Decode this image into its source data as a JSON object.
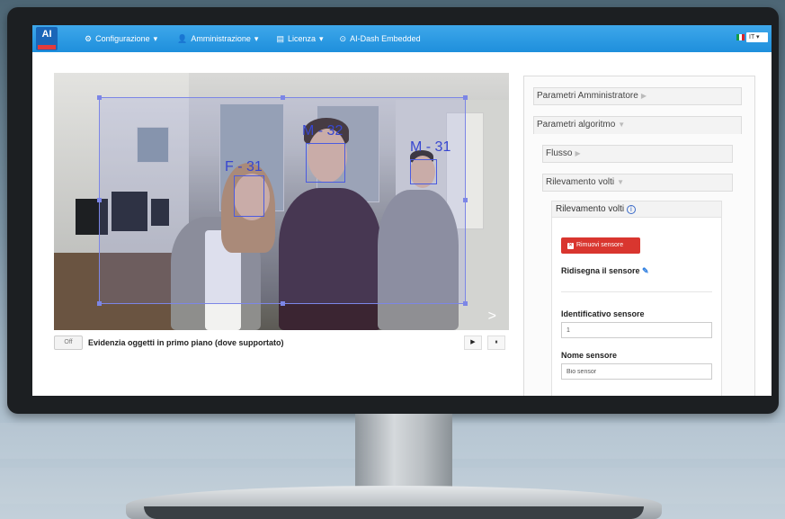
{
  "navbar": {
    "logo_text": "AI",
    "items": [
      {
        "label": "Configurazione",
        "icon": "gear-icon"
      },
      {
        "label": "Amministrazione",
        "icon": "user-icon"
      },
      {
        "label": "Licenza",
        "icon": "license-icon"
      },
      {
        "label": "AI-Dash Embedded",
        "icon": "dash-icon"
      }
    ],
    "language": "IT"
  },
  "video": {
    "face_labels": [
      "M - 32",
      "F - 31",
      "M - 31"
    ],
    "next_label": ">"
  },
  "controls": {
    "toggle_state": "Off",
    "toggle_label": "Evidenzia oggetti in primo piano (dove supportato)",
    "play_label": "▶",
    "pause_label": "⏸"
  },
  "panel": {
    "admin_params": "Parametri Amministratore",
    "algo_params": "Parametri algoritmo",
    "flow": "Flusso",
    "face_detection": "Rilevamento volti",
    "face_detection_inner": "Rilevamento volti",
    "remove_sensor": "Rimuovi sensore",
    "redraw_sensor": "Ridisegna il sensore",
    "sensor_id_label": "Identificativo sensore",
    "sensor_id_value": "1",
    "sensor_name_label": "Nome sensore",
    "sensor_name_value": "Bio sensor"
  },
  "colors": {
    "navbar": "#2196e0",
    "remove_button": "#d9362f",
    "roi_box": "#7c86e6",
    "face_box": "#4b5be0"
  }
}
